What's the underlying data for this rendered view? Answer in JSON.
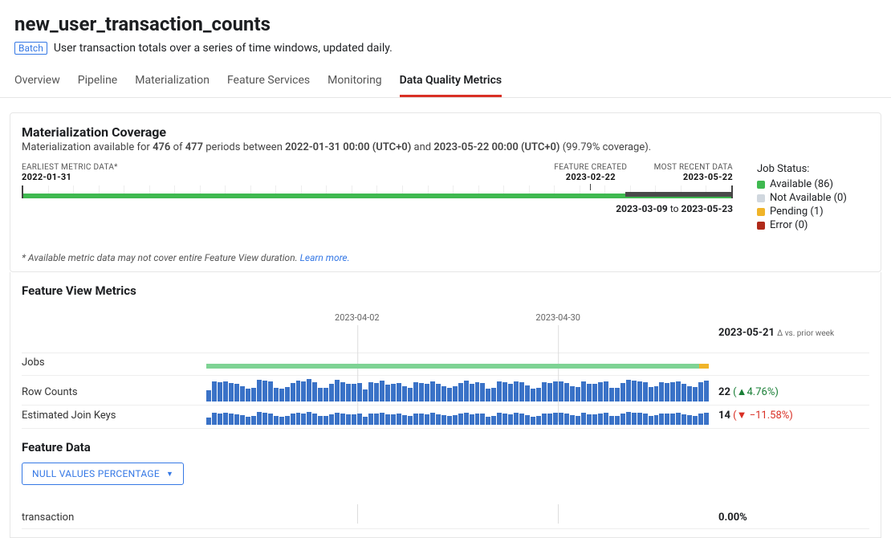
{
  "header": {
    "title": "new_user_transaction_counts",
    "badge": "Batch",
    "description": "User transaction totals over a series of time windows, updated daily."
  },
  "tabs": [
    "Overview",
    "Pipeline",
    "Materialization",
    "Feature Services",
    "Monitoring",
    "Data Quality Metrics"
  ],
  "active_tab": 5,
  "coverage": {
    "title": "Materialization Coverage",
    "available": "476",
    "total": "477",
    "start": "2022-01-31 00:00 (UTC+0)",
    "end": "2023-05-22 00:00 (UTC+0)",
    "pct": "99.79%",
    "labels": {
      "earliest_title": "EARLIEST METRIC DATA*",
      "earliest_date": "2022-01-31",
      "feature_created_title": "FEATURE CREATED",
      "feature_created_date": "2023-02-22",
      "most_recent_title": "MOST RECENT DATA",
      "most_recent_date": "2023-05-22"
    },
    "range": {
      "from": "2023-03-09",
      "to": "2023-05-23",
      "joiner": "to"
    },
    "footnote_text": "* Available metric data may not cover entire Feature View duration.",
    "footnote_link": "Learn more."
  },
  "legend": {
    "title": "Job Status:",
    "items": [
      {
        "label": "Available (86)",
        "color": "#3fb950"
      },
      {
        "label": "Not Available (0)",
        "color": "#d0d7de"
      },
      {
        "label": "Pending (1)",
        "color": "#f0b429"
      },
      {
        "label": "Error (0)",
        "color": "#b02a1a"
      }
    ]
  },
  "feature_view": {
    "title": "Feature View Metrics",
    "date_ticks": [
      "2023-04-02",
      "2023-04-30"
    ],
    "header_date": "2023-05-21",
    "header_sub": "Δ vs. prior week",
    "metrics": [
      {
        "label": "Jobs",
        "type": "jobs",
        "value": "",
        "delta": ""
      },
      {
        "label": "Row Counts",
        "type": "bars_tall",
        "value": "22",
        "delta": "(▲4.76%)",
        "dir": "up"
      },
      {
        "label": "Estimated Join Keys",
        "type": "bars_short",
        "value": "14",
        "delta": "(▼ −11.58%)",
        "dir": "down"
      }
    ]
  },
  "feature_data": {
    "title": "Feature Data",
    "dropdown": "NULL VALUES PERCENTAGE",
    "rows": [
      {
        "label": "transaction",
        "value": "0.00%"
      }
    ]
  },
  "chart_data": [
    {
      "type": "bar",
      "title": "Row Counts",
      "note": "values approximated from pixel heights; axis unlabeled",
      "x_range": [
        "~2023-03-09",
        "~2023-05-22"
      ],
      "values": [
        14,
        25,
        24,
        25,
        23,
        22,
        19,
        16,
        17,
        27,
        26,
        25,
        17,
        16,
        18,
        23,
        26,
        25,
        28,
        24,
        17,
        17,
        22,
        27,
        24,
        22,
        22,
        23,
        15,
        24,
        23,
        26,
        21,
        22,
        23,
        19,
        17,
        24,
        23,
        22,
        25,
        22,
        19,
        17,
        19,
        23,
        26,
        22,
        24,
        23,
        16,
        17,
        25,
        24,
        22,
        25,
        24,
        20,
        16,
        17,
        24,
        23,
        25,
        25,
        23,
        19,
        18,
        25,
        22,
        22,
        24,
        25,
        17,
        17,
        23,
        27,
        26,
        25,
        24,
        18,
        19,
        24,
        23,
        24,
        25,
        22,
        19,
        18,
        24,
        26
      ],
      "reference_value": 22,
      "delta_vs_prior_week_pct": 4.76
    },
    {
      "type": "bar",
      "title": "Estimated Join Keys",
      "note": "values approximated from pixel heights; axis unlabeled",
      "x_range": [
        "~2023-03-09",
        "~2023-05-22"
      ],
      "values": [
        9,
        15,
        14,
        15,
        14,
        13,
        12,
        10,
        11,
        16,
        15,
        14,
        11,
        10,
        11,
        14,
        15,
        14,
        16,
        14,
        11,
        11,
        13,
        15,
        14,
        13,
        13,
        14,
        10,
        14,
        14,
        15,
        13,
        13,
        14,
        12,
        11,
        14,
        14,
        13,
        15,
        13,
        12,
        11,
        12,
        14,
        15,
        13,
        14,
        14,
        10,
        11,
        15,
        14,
        13,
        15,
        14,
        12,
        10,
        11,
        14,
        14,
        15,
        15,
        14,
        12,
        11,
        15,
        13,
        13,
        14,
        15,
        11,
        11,
        14,
        16,
        15,
        15,
        14,
        11,
        12,
        14,
        14,
        14,
        15,
        13,
        12,
        11,
        14,
        15
      ],
      "reference_value": 14,
      "delta_vs_prior_week_pct": -11.58
    }
  ]
}
